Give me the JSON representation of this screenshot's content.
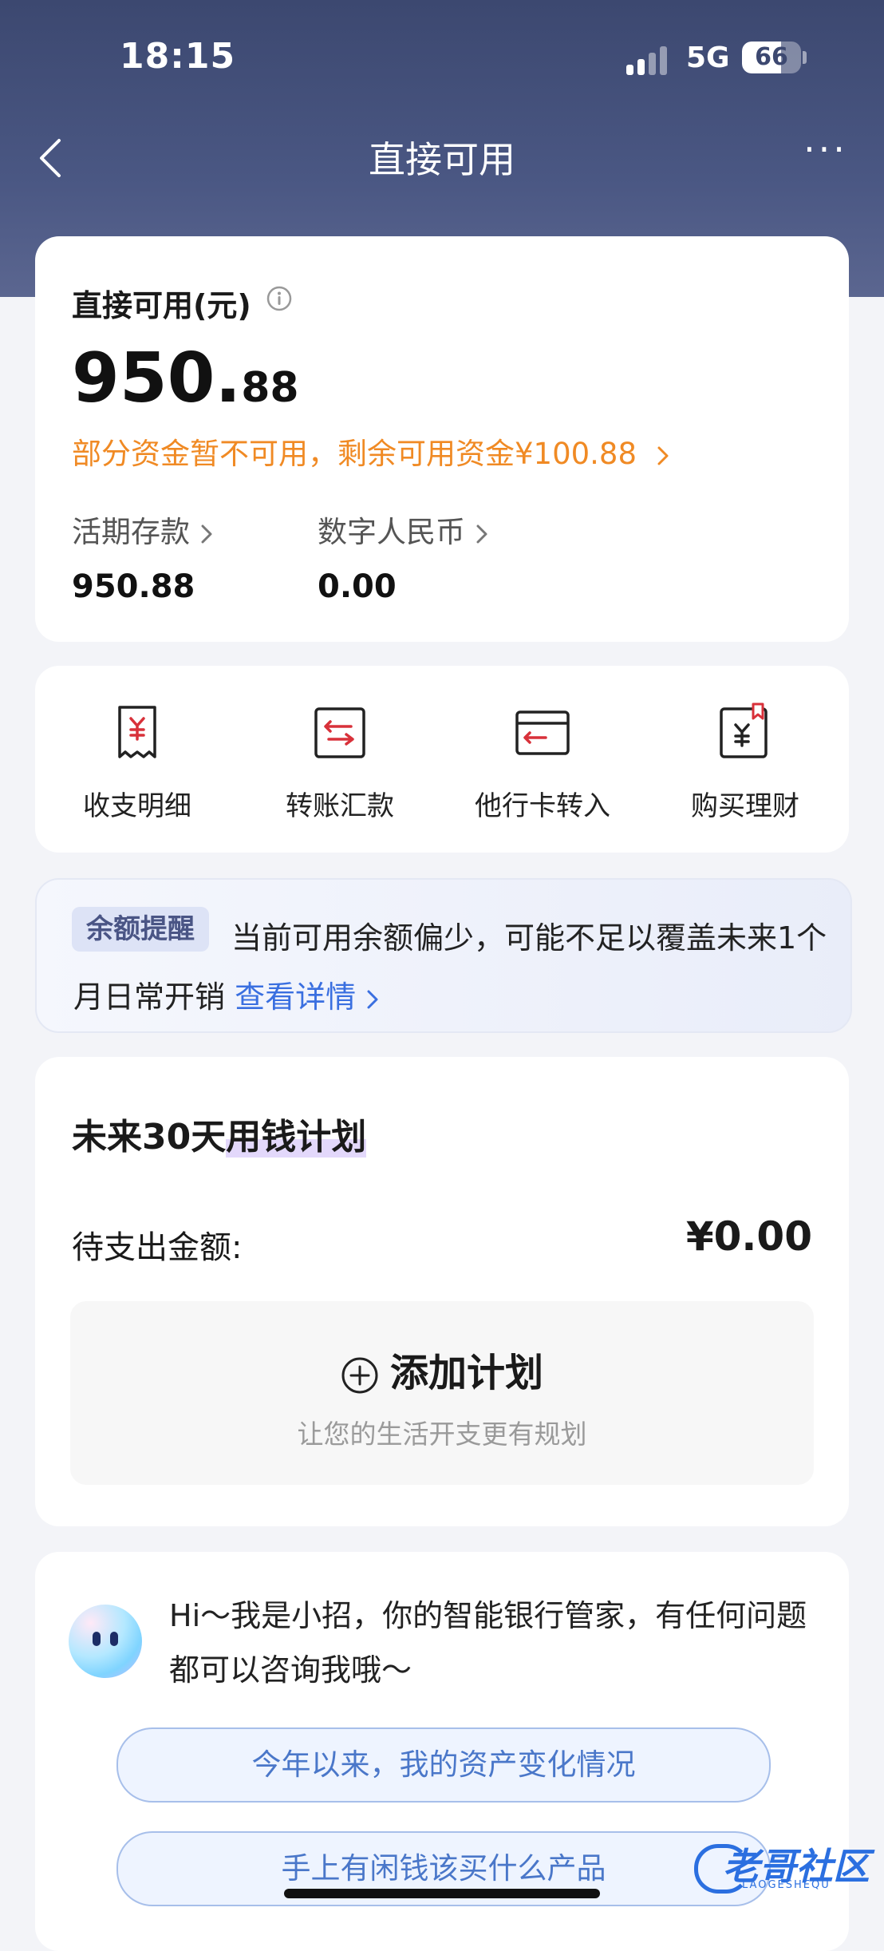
{
  "status_bar": {
    "time": "18:15",
    "network": "5G",
    "battery_level": "66",
    "battery_fraction": 0.66
  },
  "nav": {
    "title": "直接可用",
    "more": "···"
  },
  "balance": {
    "label": "直接可用(元)",
    "amount_int": "950.",
    "amount_dec": "88",
    "warning": "部分资金暂不可用，剩余可用资金¥100.88",
    "demand_label": "活期存款",
    "demand_value": "950.88",
    "ecny_label": "数字人民币",
    "ecny_value": "0.00"
  },
  "actions": [
    {
      "label": "收支明细",
      "icon": "receipt-icon"
    },
    {
      "label": "转账汇款",
      "icon": "transfer-icon"
    },
    {
      "label": "他行卡转入",
      "icon": "card-transfer-in-icon"
    },
    {
      "label": "购买理财",
      "icon": "wealth-bookmark-icon"
    }
  ],
  "tip": {
    "badge": "余额提醒",
    "text": "当前可用余额偏少，可能不足以覆盖未来1个月日常开销 ",
    "link": "查看详情"
  },
  "plan": {
    "title_prefix": "未来30天",
    "title_highlight": "用钱计划",
    "pending_label": "待支出金额:",
    "pending_value": "¥0.00",
    "add_label": "添加计划",
    "add_hint": "让您的生活开支更有规划"
  },
  "assistant": {
    "message": "Hi～我是小招，你的智能银行管家，有任何问题都可以咨询我哦～",
    "questions": [
      "今年以来，我的资产变化情况",
      "手上有闲钱该买什么产品"
    ]
  },
  "watermark": {
    "text": "老哥社区",
    "sub": "LAOGESHEQU"
  },
  "colors": {
    "header": "#3c4870",
    "accent_orange": "#f08a24",
    "link_blue": "#3a6fe0",
    "brand_red": "#d8313a"
  }
}
